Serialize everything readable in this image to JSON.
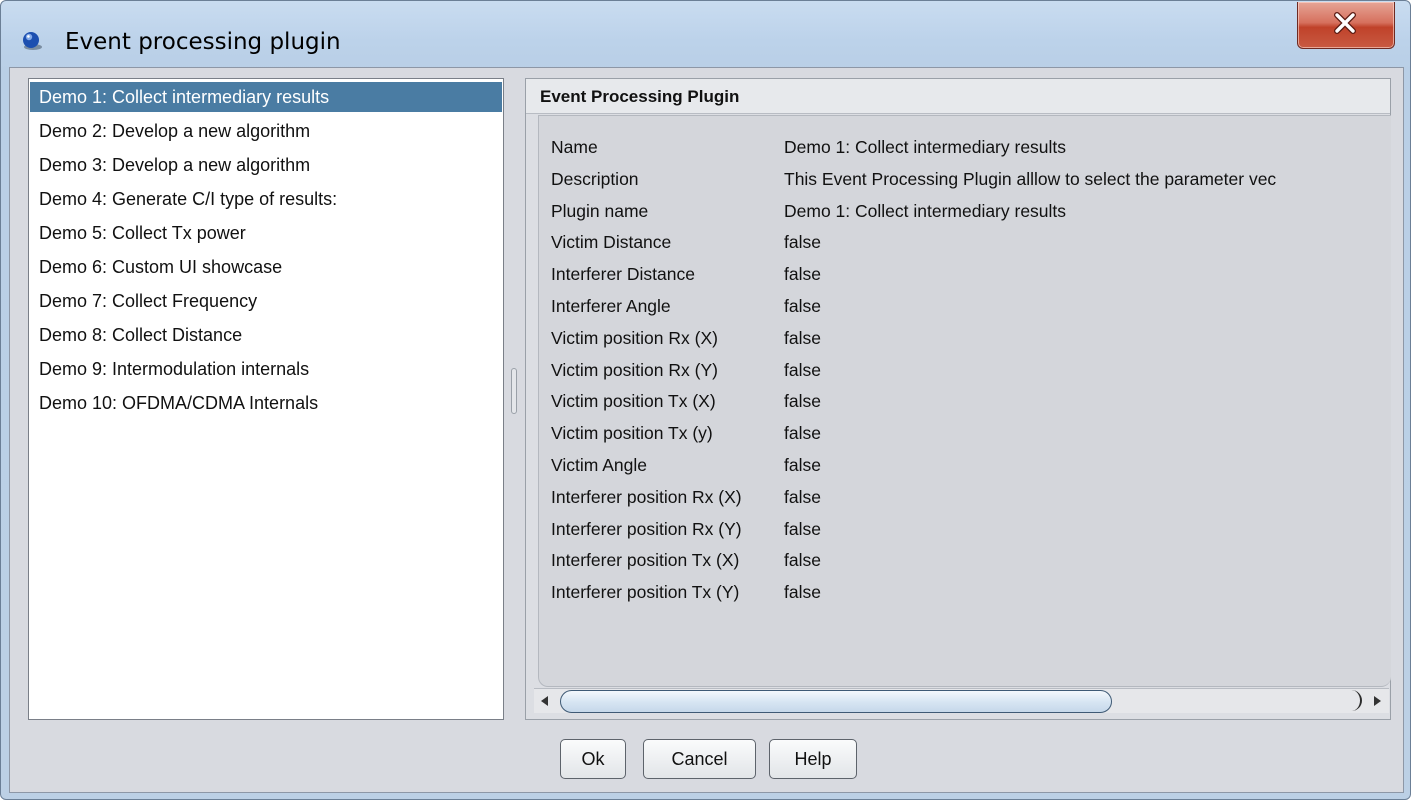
{
  "window": {
    "title": "Event processing plugin",
    "icon": "blue-sphere-icon",
    "close_icon": "close-x-icon",
    "accent": "#4a7ca3"
  },
  "list": {
    "items": [
      {
        "label": "Demo 1: Collect intermediary results",
        "selected": true
      },
      {
        "label": "Demo 2: Develop a new algorithm",
        "selected": false
      },
      {
        "label": "Demo 3: Develop a new algorithm",
        "selected": false
      },
      {
        "label": "Demo 4: Generate C/I type of results:",
        "selected": false
      },
      {
        "label": "Demo 5: Collect Tx power",
        "selected": false
      },
      {
        "label": "Demo 6: Custom UI showcase",
        "selected": false
      },
      {
        "label": "Demo 7: Collect Frequency",
        "selected": false
      },
      {
        "label": "Demo 8: Collect Distance",
        "selected": false
      },
      {
        "label": "Demo 9: Intermodulation internals",
        "selected": false
      },
      {
        "label": "Demo 10: OFDMA/CDMA Internals",
        "selected": false
      }
    ]
  },
  "details": {
    "header": "Event Processing Plugin",
    "rows": [
      {
        "key": "Name",
        "value": "Demo 1: Collect intermediary results"
      },
      {
        "key": "Description",
        "value": "This Event Processing Plugin alllow to select the parameter vec"
      },
      {
        "key": "Plugin name",
        "value": "Demo 1: Collect intermediary results"
      },
      {
        "key": "Victim Distance",
        "value": "false"
      },
      {
        "key": "Interferer Distance",
        "value": "false"
      },
      {
        "key": "Interferer Angle",
        "value": "false"
      },
      {
        "key": "Victim position Rx (X)",
        "value": "false"
      },
      {
        "key": "Victim position Rx (Y)",
        "value": "false"
      },
      {
        "key": "Victim position Tx (X)",
        "value": "false"
      },
      {
        "key": "Victim position Tx (y)",
        "value": "false"
      },
      {
        "key": "Victim Angle",
        "value": "false"
      },
      {
        "key": "Interferer position Rx (X)",
        "value": "false"
      },
      {
        "key": "Interferer position Rx (Y)",
        "value": "false"
      },
      {
        "key": "Interferer position Tx (X)",
        "value": "false"
      },
      {
        "key": "Interferer position Tx (Y)",
        "value": "false"
      }
    ]
  },
  "buttons": {
    "ok": "Ok",
    "cancel": "Cancel",
    "help": "Help"
  }
}
